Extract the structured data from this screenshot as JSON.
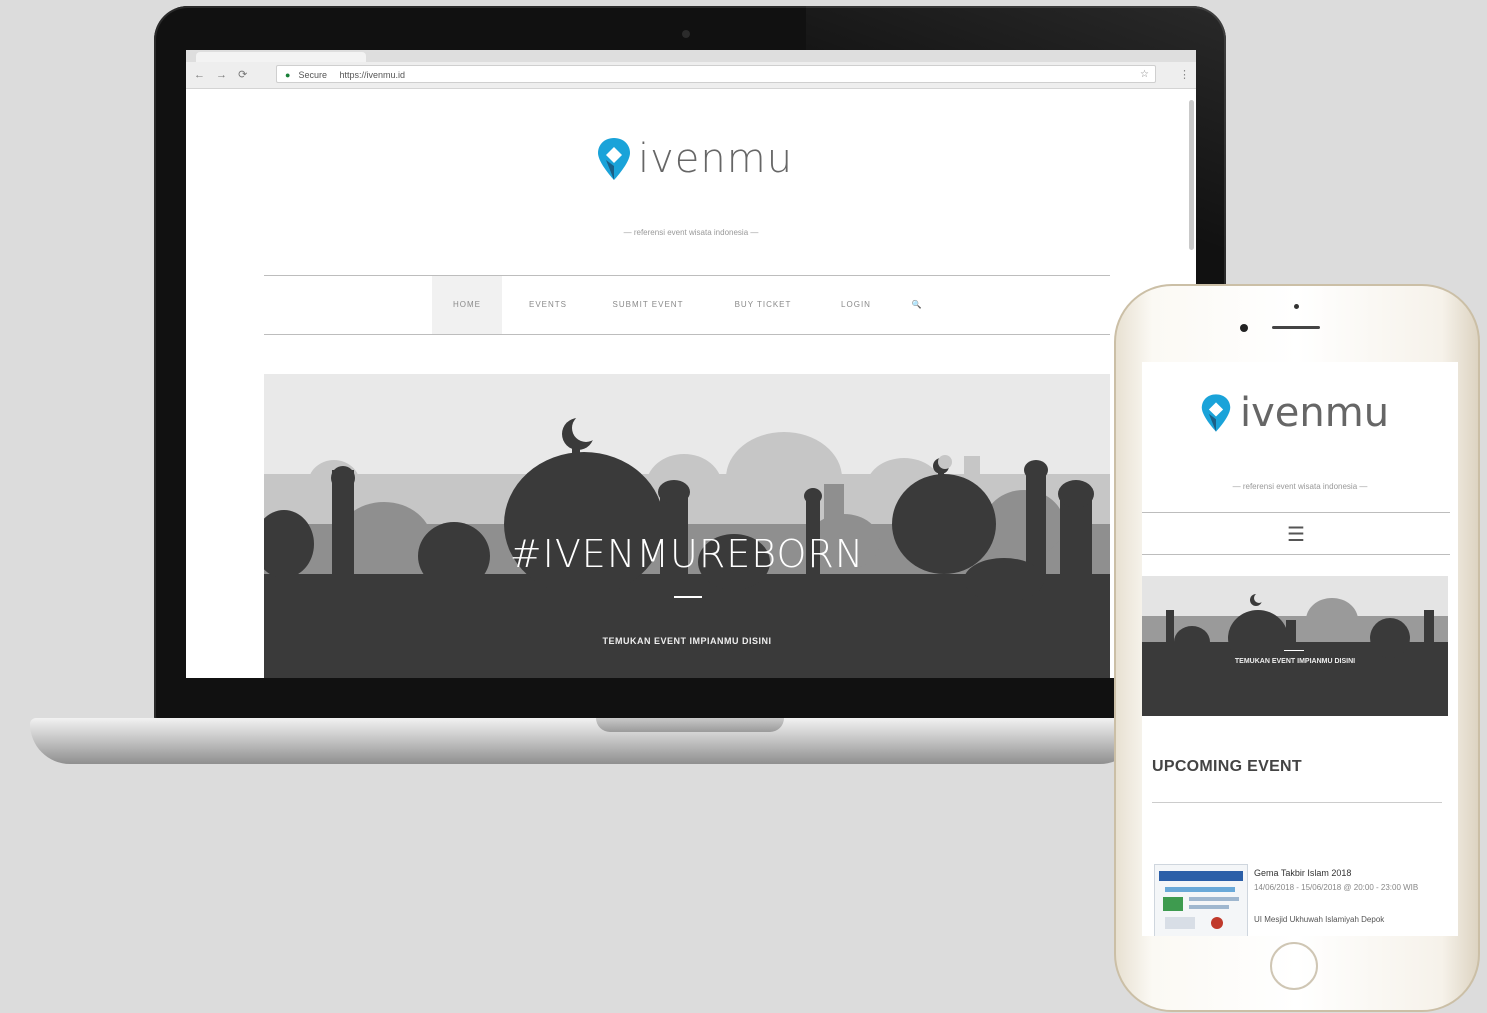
{
  "browser": {
    "secure_label": "Secure",
    "url": "https://ivenmu.id",
    "nav_glyphs": "← → ⟳"
  },
  "site": {
    "brand": "ivenmu",
    "tagline": "— referensi event wisata indonesia —",
    "nav": [
      "HOME",
      "EVENTS",
      "SUBMIT EVENT",
      "BUY TICKET",
      "LOGIN"
    ],
    "search_glyph": "🔍",
    "hero_title": "#IVENMUREBORN",
    "hero_subtitle": "TEMUKAN EVENT IMPIANMU DISINI"
  },
  "mobile": {
    "brand": "ivenmu",
    "tagline": "— referensi event wisata indonesia —",
    "menu_glyph": "☰",
    "hero_subtitle": "TEMUKAN EVENT IMPIANMU DISINI",
    "section_title": "UPCOMING EVENT",
    "event": {
      "title": "Gema Takbir Islam 2018",
      "date": "14/06/2018 - 15/06/2018 @ 20:00 - 23:00 WIB",
      "venue": "UI Mesjid Ukhuwah Islamiyah Depok"
    }
  },
  "colors": {
    "brand_blue": "#1aa3d9",
    "brand_dark": "#1b5f86",
    "text_grey": "#666666",
    "background": "#dcdcdc"
  },
  "icons": [
    "map-pin-logo-icon",
    "search-icon",
    "hamburger-menu-icon",
    "crescent-moon-icon",
    "lock-icon",
    "star-icon"
  ]
}
